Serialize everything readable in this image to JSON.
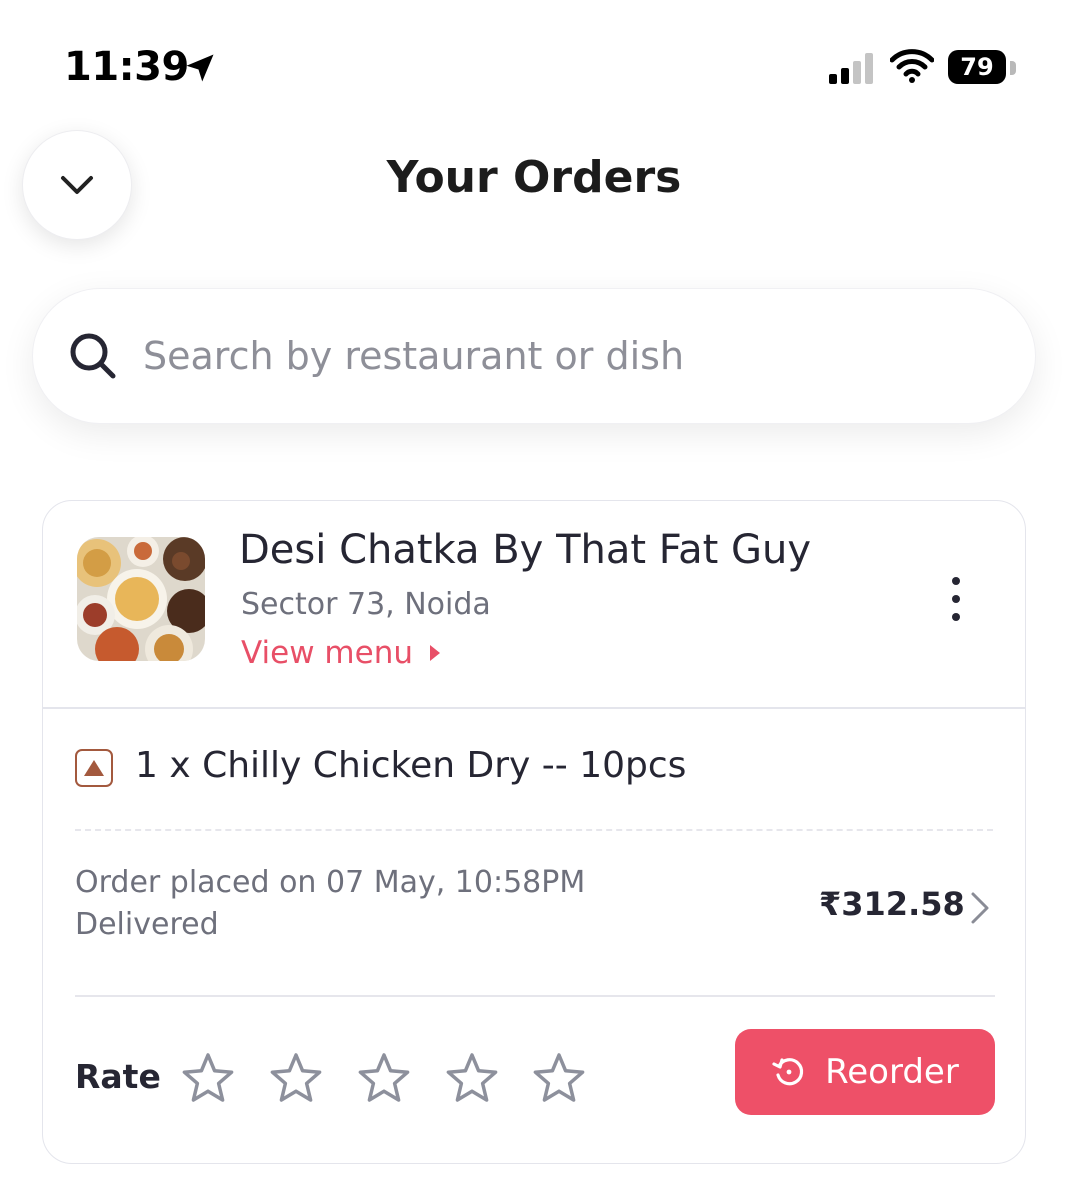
{
  "status_bar": {
    "time": "11:39",
    "battery": "79",
    "icons": [
      "location-arrow-icon",
      "cellular-signal-icon",
      "wifi-icon",
      "battery-icon"
    ]
  },
  "header": {
    "title": "Your Orders",
    "back_icon": "chevron-down-icon"
  },
  "search": {
    "placeholder": "Search by restaurant or dish",
    "icon": "search-icon"
  },
  "order": {
    "restaurant_name": "Desi Chatka By That Fat Guy",
    "location": "Sector 73, Noida",
    "view_menu_label": "View menu",
    "items": [
      {
        "text": "1 x Chilly Chicken Dry -- 10pcs",
        "type": "non-veg"
      }
    ],
    "placed_text": "Order placed on 07 May, 10:58PM",
    "status": "Delivered",
    "total": "₹312.58",
    "rate_label": "Rate",
    "star_count": 5,
    "rating": 0,
    "reorder_label": "Reorder"
  },
  "colors": {
    "accent": "#e84f67",
    "reorder_bg": "#ee5068",
    "text_primary": "#262633",
    "text_secondary": "#6e707c",
    "nonveg": "#a3593e"
  }
}
